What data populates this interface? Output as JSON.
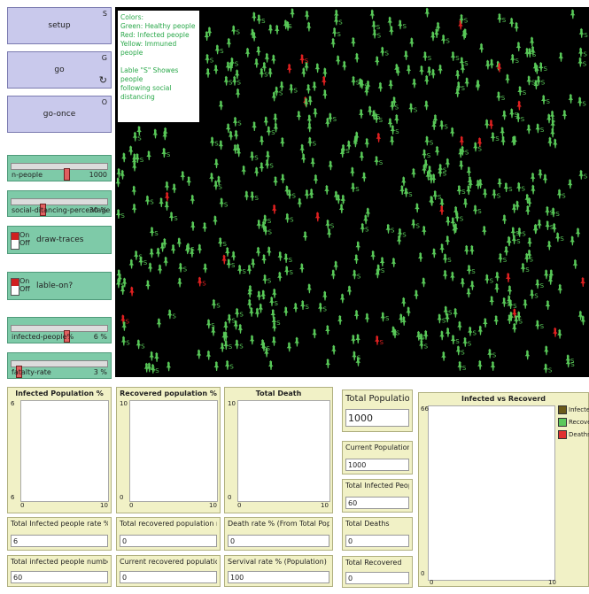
{
  "buttons": {
    "setup": {
      "label": "setup",
      "key": "S"
    },
    "go": {
      "label": "go",
      "key": "G",
      "loop_icon": "↻"
    },
    "go_once": {
      "label": "go-once",
      "key": "O"
    }
  },
  "sliders": {
    "n_people": {
      "label": "n-people",
      "value": "1000",
      "fraction": 0.55
    },
    "social": {
      "label": "social-ditancing-percentage",
      "value": "30 %",
      "fraction": 0.3
    },
    "infected": {
      "label": "infected-people%",
      "value": "6 %",
      "fraction": 0.55
    },
    "fatality": {
      "label": "fatalty-rate",
      "value": "3 %",
      "fraction": 0.05
    }
  },
  "switches": {
    "draw_traces": {
      "on": "On",
      "off": "Off",
      "label": "draw-traces"
    },
    "lable_on": {
      "on": "On",
      "off": "Off",
      "label": "lable-on?"
    }
  },
  "legend": {
    "line1": "Colors:",
    "line2": "Green: Healthy people",
    "line3": "Red: Infected people",
    "line4": "Yellow: Immuned people",
    "line5": "Lable \"S\" Showes people",
    "line6": "following social distancing"
  },
  "world": {
    "label_s": "S",
    "healthy_color": "#58c858",
    "infected_color": "#e02020"
  },
  "plots": {
    "infected_pct": {
      "title": "Infected Population %",
      "ymax": "6",
      "ymin": "6",
      "xmin": "0",
      "xmax": "10"
    },
    "recovered_pct": {
      "title": "Recovered population %",
      "ymax": "10",
      "ymin": "0",
      "xmin": "0",
      "xmax": "10"
    },
    "total_death": {
      "title": "Total Death",
      "ymax": "10",
      "ymin": "0",
      "xmin": "0",
      "xmax": "10"
    },
    "inf_vs_rec": {
      "title": "Infected vs Recoverd",
      "ymax": "66",
      "ymin": "0",
      "xmin": "0",
      "xmax": "10",
      "legend": [
        {
          "name": "Infected",
          "color": "#6b5a1a"
        },
        {
          "name": "Recovered",
          "color": "#5cc85c"
        },
        {
          "name": "Deaths",
          "color": "#e03030"
        }
      ]
    }
  },
  "monitors": {
    "total_population": {
      "label": "Total Population",
      "value": "1000"
    },
    "current_population": {
      "label": "Current  Population",
      "value": "1000"
    },
    "total_infected_people": {
      "label": "Total Infected People",
      "value": "60"
    },
    "total_deaths": {
      "label": "Total Deaths",
      "value": "0"
    },
    "total_recovered": {
      "label": "Total Recovered",
      "value": "0"
    },
    "total_infected_rate": {
      "label": "Total Infected people rate %",
      "value": "6"
    },
    "total_infected_number": {
      "label": "Total infected people number",
      "value": "60"
    },
    "total_recovered_rate": {
      "label": "Total recovered population rate (...",
      "value": "0"
    },
    "current_recovered_rate": {
      "label": "Current recovered population rate ...",
      "value": "0"
    },
    "death_rate": {
      "label": "Death rate % (From Total Pop)",
      "value": "0"
    },
    "survival_rate": {
      "label": "Servival rate % (Population)",
      "value": "100"
    }
  }
}
